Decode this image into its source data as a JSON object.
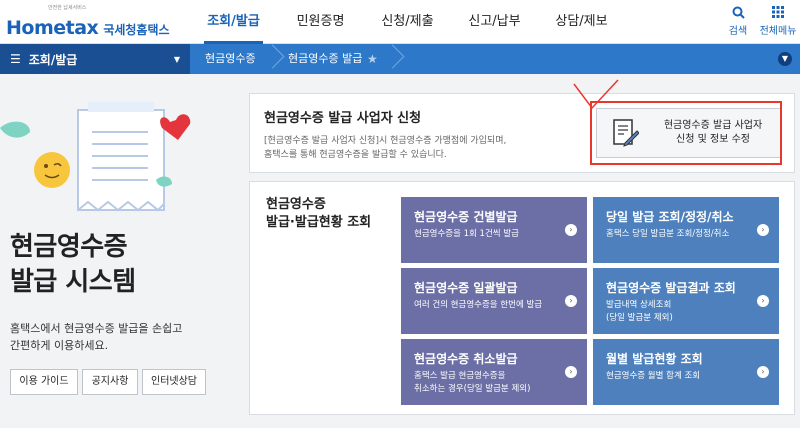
{
  "header": {
    "logo_main": "Hometax",
    "logo_tagline": "안전한 납세서비스",
    "logo_kr": "국세청홈택스",
    "nav": [
      "조회/발급",
      "민원증명",
      "신청/제출",
      "신고/납부",
      "상담/제보"
    ],
    "active_nav": "조회/발급",
    "search_label": "검색",
    "allmenu_label": "전체메뉴"
  },
  "breadcrumb": {
    "menu": "조회/발급",
    "items": [
      "현금영수증",
      "현금영수증 발급"
    ]
  },
  "hero": {
    "title_line1": "현금영수증",
    "title_line2": "발급 시스템",
    "desc_line1": "홈택스에서 현금영수증 발급을 손쉽고",
    "desc_line2": "간편하게 이용하세요.",
    "buttons": [
      "이용 가이드",
      "공지사항",
      "인터넷상담"
    ]
  },
  "registration": {
    "title": "현금영수증 발급 사업자 신청",
    "desc_line1": "[현금영수증 발급 사업자 신청]시 현금영수증 가맹점에 가입되며,",
    "desc_line2": "홈택스를 통해 현금영수증을 발급할 수 있습니다.",
    "button_line1": "현금영수증 발급 사업자",
    "button_line2": "신청 및 정보 수정"
  },
  "inquiry": {
    "title_line1": "현금영수증",
    "title_line2": "발급·발급현황 조회",
    "tiles": [
      {
        "title": "현금영수증 건별발급",
        "sub1": "현금영수증을 1회 1건씩 발급",
        "sub2": ""
      },
      {
        "title": "당일 발급 조회/정정/취소",
        "sub1": "홈택스 당일 발급분 조회/정정/취소",
        "sub2": ""
      },
      {
        "title": "현금영수증 일괄발급",
        "sub1": "여러 건의 현금영수증을 한번에 발급",
        "sub2": ""
      },
      {
        "title": "현금영수증 발급결과 조회",
        "sub1": "발급내역 상세조회",
        "sub2": "(당일 발급분 제외)"
      },
      {
        "title": "현금영수증 취소발급",
        "sub1": "홈택스 발급 현금영수증을",
        "sub2": "취소하는 경우(당일 발급분 제외)"
      },
      {
        "title": "월별 발급현황 조회",
        "sub1": "현금영수증 월별 합계 조회",
        "sub2": ""
      }
    ]
  },
  "colors": {
    "brand_blue": "#1a63b8",
    "tile_purple": "#6c6fa6",
    "tile_blue": "#4d80bd",
    "highlight_red": "#e8382c"
  }
}
